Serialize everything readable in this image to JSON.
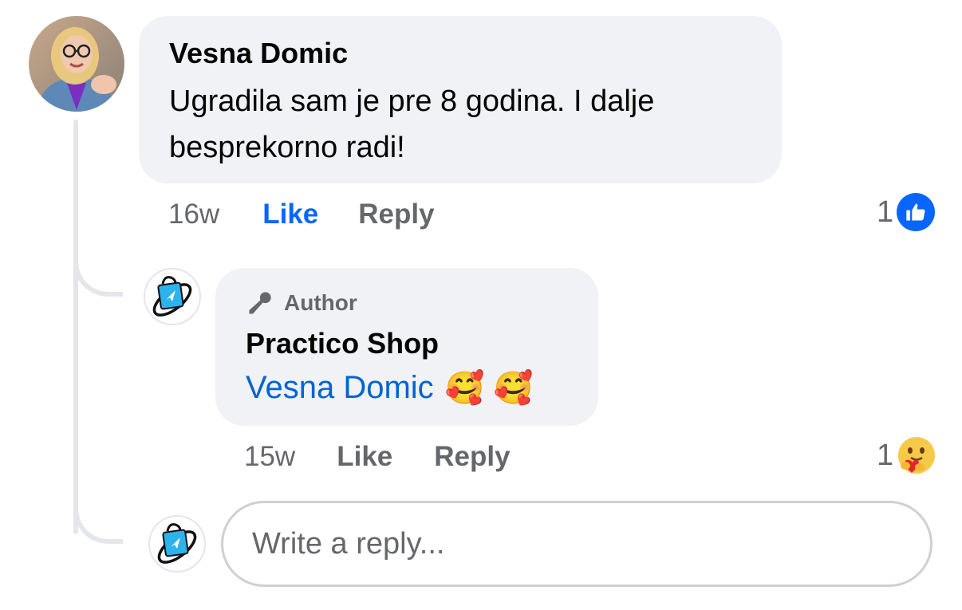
{
  "comment": {
    "author": "Vesna Domic",
    "text_line1": "Ugradila sam je pre 8 godina. I dalje",
    "text_line2": "besprekorno radi!",
    "time": "16w",
    "like_label": "Like",
    "reply_label": "Reply",
    "reaction_count": "1",
    "reaction_icon": "thumbs-up-icon",
    "like_color": "#0866ff"
  },
  "reply": {
    "badge": "Author",
    "author": "Practico Shop",
    "mention": "Vesna Domic",
    "emoji": "🥰 🥰",
    "time": "15w",
    "like_label": "Like",
    "reply_label": "Reply",
    "reaction_count": "1",
    "reaction_icon": "care-hug-emoji-icon",
    "mention_color": "#0064d1"
  },
  "composer": {
    "placeholder": "Write a reply..."
  }
}
